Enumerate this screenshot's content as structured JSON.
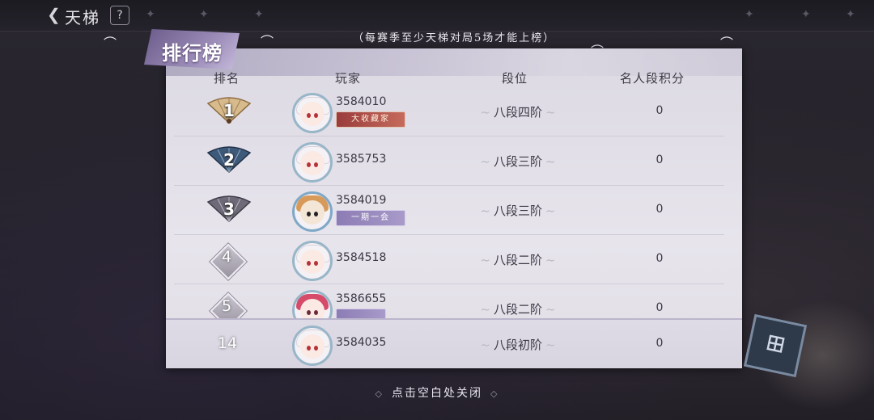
{
  "header": {
    "back_icon": "chevron-left-icon",
    "title": "天梯",
    "help_label": "?"
  },
  "notice": "（每赛季至少天梯对局5场才能上榜）",
  "panel": {
    "banner_title": "排行榜",
    "columns": {
      "rank": "排名",
      "player": "玩家",
      "tier": "段位",
      "score": "名人段积分"
    }
  },
  "rows": [
    {
      "rank": "1",
      "rank_style": "gold-fan",
      "player_id": "3584010",
      "title_tag": "大收藏家",
      "tag_style": "red",
      "tier": "八段四阶",
      "score": "0"
    },
    {
      "rank": "2",
      "rank_style": "blue-fan",
      "player_id": "3585753",
      "title_tag": "",
      "tag_style": "",
      "tier": "八段三阶",
      "score": "0"
    },
    {
      "rank": "3",
      "rank_style": "grey-fan",
      "player_id": "3584019",
      "title_tag": "一期一会",
      "tag_style": "purple",
      "tier": "八段三阶",
      "score": "0"
    },
    {
      "rank": "4",
      "rank_style": "diamond",
      "player_id": "3584518",
      "title_tag": "",
      "tag_style": "",
      "tier": "八段二阶",
      "score": "0"
    },
    {
      "rank": "5",
      "rank_style": "diamond",
      "player_id": "3586655",
      "title_tag": "",
      "tag_style": "purple",
      "tier": "八段二阶",
      "score": "0"
    }
  ],
  "my_row": {
    "rank": "14",
    "player_id": "3584035",
    "tier": "八段初阶",
    "score": "0"
  },
  "close_hint": "点击空白处关闭",
  "colors": {
    "gold": "#c9a874",
    "blue_fan": "#3e5a7a",
    "grey_fan": "#6e6a78",
    "accent_purple": "#8c7cb4"
  }
}
